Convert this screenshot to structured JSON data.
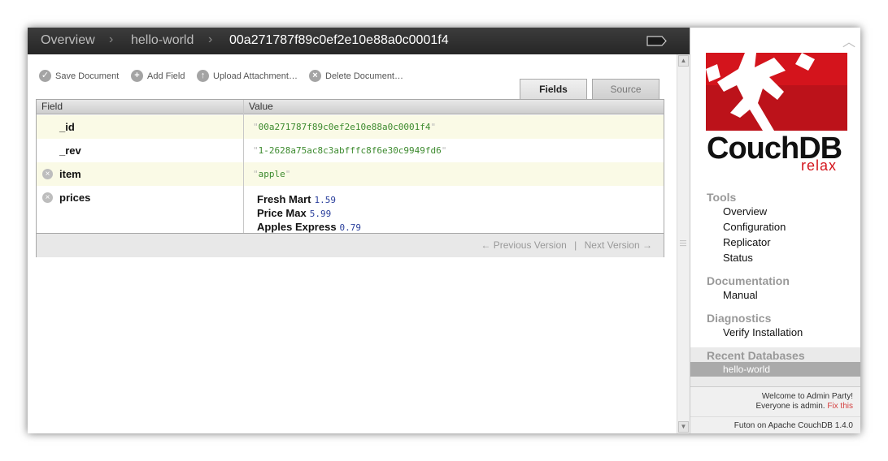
{
  "breadcrumb": {
    "overview": "Overview",
    "database": "hello-world",
    "document": "00a271787f89c0ef2e10e88a0c0001f4",
    "separator": "›"
  },
  "toolbar": {
    "save": "Save Document",
    "add_field": "Add Field",
    "upload": "Upload Attachment…",
    "delete": "Delete Document…"
  },
  "tabs": {
    "fields": "Fields",
    "source": "Source"
  },
  "table": {
    "headers": {
      "field": "Field",
      "value": "Value"
    },
    "rows": {
      "id": {
        "field": "_id",
        "value": "00a271787f89c0ef2e10e88a0c0001f4"
      },
      "rev": {
        "field": "_rev",
        "value": "1-2628a75ac8c3abfffc8f6e30c9949fd6"
      },
      "item": {
        "field": "item",
        "value": "apple"
      },
      "prices": {
        "field": "prices",
        "entries": [
          {
            "key": "Fresh Mart",
            "value": "1.59"
          },
          {
            "key": "Price Max",
            "value": "5.99"
          },
          {
            "key": "Apples Express",
            "value": "0.79"
          }
        ]
      }
    },
    "pager": {
      "previous": "← Previous Version",
      "divider": "|",
      "next": "Next Version →"
    }
  },
  "sidebar": {
    "logo_word": "CouchDB",
    "logo_tagline": "relax",
    "tools": {
      "heading": "Tools",
      "items": [
        "Overview",
        "Configuration",
        "Replicator",
        "Status"
      ]
    },
    "documentation": {
      "heading": "Documentation",
      "items": [
        "Manual"
      ]
    },
    "diagnostics": {
      "heading": "Diagnostics",
      "items": [
        "Verify Installation"
      ]
    },
    "recent": {
      "heading": "Recent Databases",
      "items": [
        "hello-world"
      ]
    },
    "footer": {
      "welcome": "Welcome to Admin Party!",
      "everyone": "Everyone is admin.",
      "fix": "Fix this",
      "version": "Futon on Apache CouchDB 1.4.0"
    }
  },
  "colors": {
    "header_bg": "#2f2f2f",
    "couch_red": "#d4141c",
    "string_green": "#3c8a2e",
    "number_blue": "#2a3f9c",
    "row_highlight": "#fafae6"
  },
  "icons": {
    "save": "check-circle-icon",
    "add": "plus-circle-icon",
    "upload": "upload-circle-icon",
    "delete": "x-circle-icon",
    "tag": "tag-icon"
  }
}
